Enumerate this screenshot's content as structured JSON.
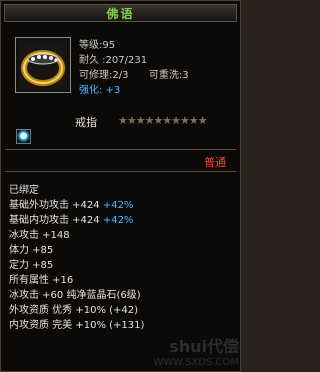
{
  "window": {
    "title": "佛语"
  },
  "item": {
    "level": "等级:95",
    "durability": "耐久 :207/231",
    "repairable": "可修理:2/3",
    "rewashable": "可重洗:3",
    "refine": "强化: +3",
    "type": "戒指",
    "stars": "★★★★★★★★★★",
    "rarity": "普通",
    "colors": {
      "title": "#7fd14a",
      "refine": "#4fb7ff",
      "rarity": "#ff3b2f",
      "attrs": "#e8e2d6"
    }
  },
  "attributes": [
    {
      "text": "已绑定",
      "extra": ""
    },
    {
      "text": "基础外功攻击 +424 ",
      "extra": "+42%"
    },
    {
      "text": "基础内功攻击 +424 ",
      "extra": "+42%"
    },
    {
      "text": "冰攻击 +148",
      "extra": ""
    },
    {
      "text": "体力 +85",
      "extra": ""
    },
    {
      "text": "定力 +85",
      "extra": ""
    },
    {
      "text": "所有属性 +16",
      "extra": ""
    },
    {
      "text": "冰攻击 +60 纯净蓝晶石(6级)",
      "extra": ""
    },
    {
      "text": "外攻资质  优秀 +10% (+42)",
      "extra": ""
    },
    {
      "text": "内攻资质  完美 +10% (+131)",
      "extra": ""
    }
  ],
  "watermark": {
    "brand": "shui代偿",
    "url": "WWW.SXDS.COM"
  }
}
